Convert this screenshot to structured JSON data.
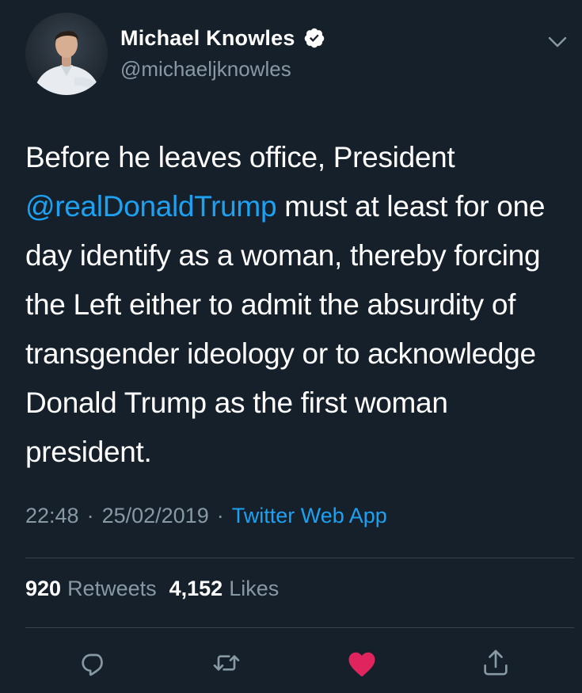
{
  "author": {
    "display_name": "Michael Knowles",
    "handle": "@michaeljknowles",
    "verified": true
  },
  "tweet": {
    "mention": "@realDonaldTrump",
    "text_before": "Before he leaves office, President ",
    "text_after": " must at least for one day identify as a woman, thereby forcing the Left either to admit the absurdity of transgender ideology or to acknowledge Donald Trump as the first woman president."
  },
  "meta": {
    "time": "22:48",
    "separator1": "·",
    "date": "25/02/2019",
    "separator2": "·",
    "source": "Twitter Web App"
  },
  "stats": {
    "retweets_count": "920",
    "retweets_label": "Retweets",
    "likes_count": "4,152",
    "likes_label": "Likes"
  },
  "actions": {
    "reply_icon": "reply-icon",
    "retweet_icon": "retweet-icon",
    "like_icon": "heart-icon",
    "share_icon": "share-icon"
  },
  "colors": {
    "background": "#15202b",
    "primary_text": "#ffffff",
    "secondary_text": "#8899a6",
    "accent": "#1da1f2",
    "like_active": "#e0245e",
    "divider": "#38444d"
  }
}
